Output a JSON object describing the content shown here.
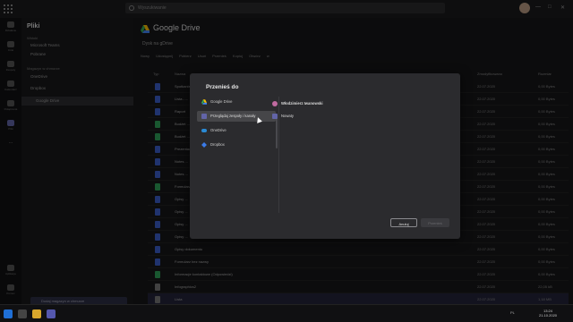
{
  "topbar": {
    "search_placeholder": "Wyszukiwanie",
    "minimize": "—",
    "maximize": "□",
    "close": "✕"
  },
  "rail": [
    {
      "label": "Działanie",
      "icon": "bell-icon"
    },
    {
      "label": "Czat",
      "icon": "chat-icon"
    },
    {
      "label": "Zespoły",
      "icon": "teams-icon"
    },
    {
      "label": "Kalendarz",
      "icon": "calendar-icon"
    },
    {
      "label": "Połączenia",
      "icon": "phone-icon"
    },
    {
      "label": "Pliki",
      "icon": "files-icon"
    },
    {
      "label": "...",
      "icon": "more-icon"
    }
  ],
  "rail_bottom": [
    {
      "label": "Aplikacje",
      "icon": "apps-icon"
    },
    {
      "label": "Pomoc",
      "icon": "help-icon"
    }
  ],
  "panel": {
    "title": "Pliki",
    "section1": "Widoki",
    "items1": [
      "Microsoft Teams",
      "Pobrane"
    ],
    "section2": "Magazyn w chmurze",
    "items2": [
      "OneDrive",
      "Dropbox",
      "Google Drive"
    ],
    "bottom_button": "Dodaj magazyn w chmurze"
  },
  "main": {
    "title": "Google Drive",
    "breadcrumb": "Dysk na gDrive",
    "toolbar": "Nowy  Udostępnij  Pobierz  Usuń  Przenieś  Kopiuj  Otwórz w",
    "headers": {
      "type": "Typ",
      "name": "Nazwa",
      "modified": "Zmodyfikowano",
      "size": "Rozmiar"
    },
    "rows": [
      {
        "name": "Spotkanie - ...",
        "date": "22.07.2020",
        "size": "0,00 Bytes",
        "kind": "b"
      },
      {
        "name": "Lista - ...",
        "date": "22.07.2020",
        "size": "0,00 Bytes",
        "kind": "b"
      },
      {
        "name": "Raport",
        "date": "22.07.2020",
        "size": "0,00 Bytes",
        "kind": "b"
      },
      {
        "name": "Budżet ...",
        "date": "22.07.2020",
        "size": "0,00 Bytes",
        "kind": "g"
      },
      {
        "name": "Budżet ...",
        "date": "22.07.2020",
        "size": "0,00 Bytes",
        "kind": "g"
      },
      {
        "name": "Prezentacja",
        "date": "22.07.2020",
        "size": "0,00 Bytes",
        "kind": "b"
      },
      {
        "name": "Notes ...",
        "date": "22.07.2020",
        "size": "0,00 Bytes",
        "kind": "b"
      },
      {
        "name": "Notes ...",
        "date": "22.07.2020",
        "size": "0,00 Bytes",
        "kind": "b"
      },
      {
        "name": "Formularz",
        "date": "22.07.2020",
        "size": "0,00 Bytes",
        "kind": "g"
      },
      {
        "name": "Opisy ...",
        "date": "22.07.2020",
        "size": "0,00 Bytes",
        "kind": "b"
      },
      {
        "name": "Opisy ...",
        "date": "22.07.2020",
        "size": "0,00 Bytes",
        "kind": "b"
      },
      {
        "name": "Opisy ...",
        "date": "22.07.2020",
        "size": "0,00 Bytes",
        "kind": "b"
      },
      {
        "name": "Opisy ...",
        "date": "22.07.2020",
        "size": "0,00 Bytes",
        "kind": "b"
      },
      {
        "name": "Opisy dokumentu",
        "date": "22.07.2020",
        "size": "0,00 Bytes",
        "kind": "b"
      },
      {
        "name": "Formularz bez nazwy",
        "date": "22.07.2020",
        "size": "0,00 Bytes",
        "kind": "b"
      },
      {
        "name": "Informacje kontaktowe (Odpowiedzi)",
        "date": "22.07.2020",
        "size": "0,00 Bytes",
        "kind": "g"
      },
      {
        "name": "Infographics2",
        "date": "22.07.2020",
        "size": "22,05 kB",
        "kind": "w"
      },
      {
        "name": "Lista",
        "date": "22.07.2020",
        "size": "1,18 MB",
        "kind": "w",
        "highlight": true
      }
    ]
  },
  "modal": {
    "title": "Przenieś do",
    "locations": [
      {
        "label": "Google Drive",
        "icon": "google-drive-icon",
        "color": "#34a853",
        "selected": false
      },
      {
        "label": "Przeglądaj zespoły i kanały",
        "icon": "teams-icon",
        "color": "#6264a7",
        "selected": true
      },
      {
        "label": "OneDrive",
        "icon": "onedrive-icon",
        "color": "#2a8ad4",
        "selected": false
      },
      {
        "label": "Dropbox",
        "icon": "dropbox-icon",
        "color": "#3b7be8",
        "selected": false
      }
    ],
    "right_items": [
      {
        "label": "Włodzimierz Iwanowski",
        "icon": "user-icon",
        "color": "#c06aa0"
      },
      {
        "label": "Nowaty",
        "icon": "teams-icon",
        "color": "#6264a7"
      }
    ],
    "cancel_label": "Anuluj",
    "move_label": "Przenieś"
  },
  "taskbar": {
    "time": "13:24",
    "date": "21.10.2020",
    "tray": "PL"
  },
  "colors": {
    "accent": "#6264a7",
    "background": "#161618",
    "modal": "#2b2b2e"
  }
}
